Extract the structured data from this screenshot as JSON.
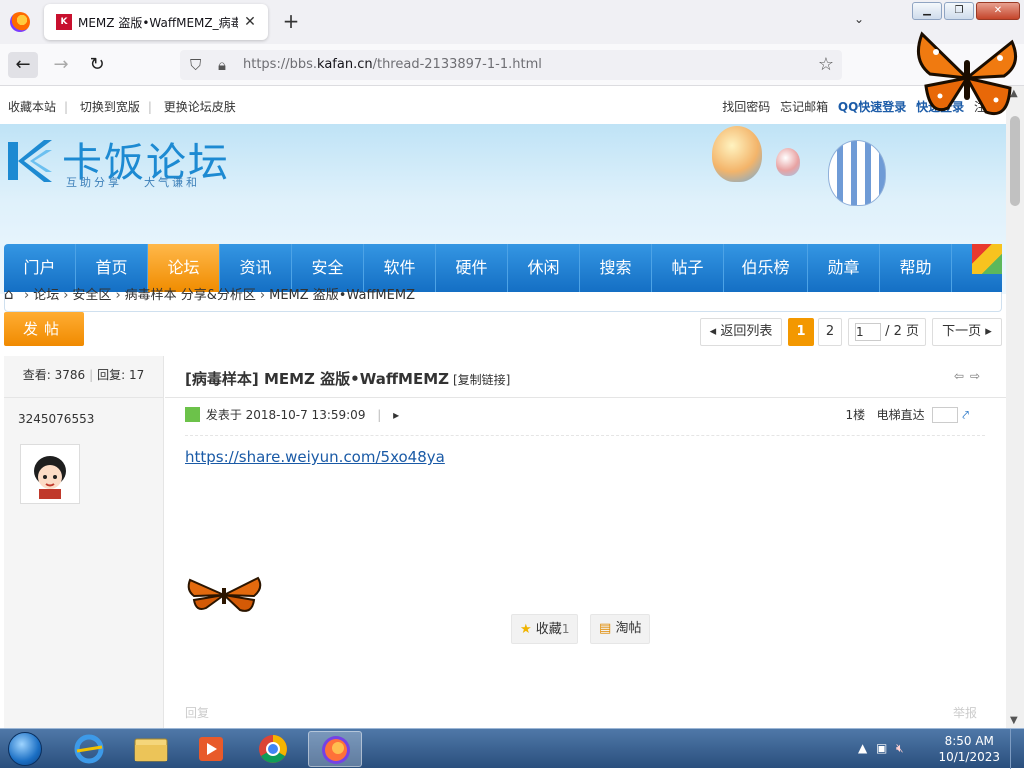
{
  "browser": {
    "tab_title": "MEMZ 盗版•WaffMEMZ_病毒样",
    "tab_favicon_text": "Kafan",
    "url_host_prefix": "https://bbs.",
    "url_domain": "kafan.cn",
    "url_path": "/thread-2133897-1-1.html"
  },
  "site": {
    "top_left": [
      "收藏本站",
      "切换到宽版",
      "更换论坛皮肤"
    ],
    "top_right": [
      "找回密码",
      "忘记邮箱"
    ],
    "qq_login": "QQ快速登录",
    "quick_login": "快速登录",
    "register": "注册",
    "logo_text": "卡饭论坛",
    "logo_sub_1": "互助分享",
    "logo_sub_2": "大气谦和",
    "nav": [
      "门户",
      "首页",
      "论坛",
      "资讯",
      "安全",
      "软件",
      "硬件",
      "休闲",
      "搜索",
      "帖子",
      "伯乐榜",
      "勋章",
      "帮助"
    ],
    "nav_active": "论坛"
  },
  "breadcrumb": [
    "论坛",
    "安全区",
    "病毒样本 分享&分析区",
    "MEMZ 盗版•WaffMEMZ"
  ],
  "thread": {
    "post_button": "发帖",
    "back_to_list": "返回列表",
    "page_current": "1",
    "page_2": "2",
    "page_input": "1",
    "page_total": "/ 2 页",
    "next_page": "下一页",
    "views_label": "查看:",
    "views": "3786",
    "replies_label": "回复:",
    "replies": "17",
    "title_tag": "[病毒样本]",
    "title": "MEMZ 盗版•WaffMEMZ",
    "copy_link": "[复制链接]",
    "author": "3245076553",
    "posted_at": "发表于 2018-10-7 13:59:09",
    "floor": "1楼",
    "jump_label": "电梯直达",
    "link": "https://share.weiyun.com/5xo48ya",
    "favorite_label": "收藏",
    "favorite_count": "1",
    "tao_label": "淘帖",
    "reply_label": "回复",
    "report_label": "举报"
  },
  "taskbar": {
    "time": "8:50 AM",
    "date": "10/1/2023"
  },
  "colors": {
    "nav_blue": "#1e7fd6",
    "nav_active": "#f39800",
    "link_blue": "#1a5aa6",
    "butterfly_orange": "#f07a10"
  }
}
